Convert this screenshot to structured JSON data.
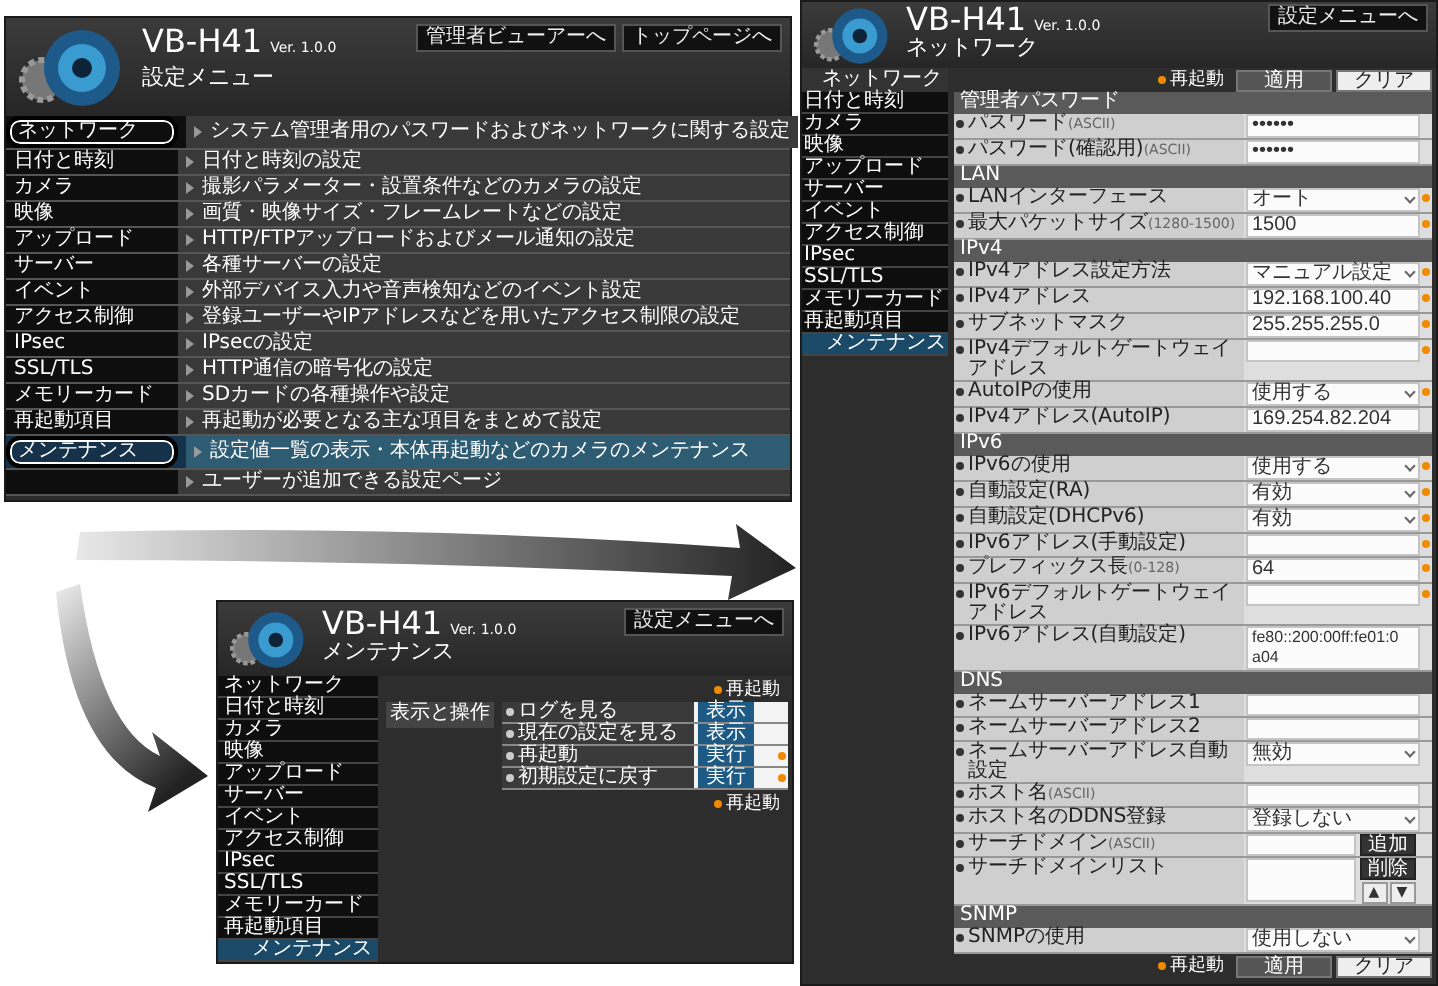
{
  "settings_menu": {
    "title": "VB-H41",
    "version": "Ver. 1.0.0",
    "header_buttons": [
      "管理者ビューアーへ",
      "トップページへ"
    ],
    "heading": "設定メニュー",
    "items": [
      {
        "name": "ネットワーク",
        "description": "システム管理者用のパスワードおよびネットワークに関する設定",
        "selected": false,
        "circled": true
      },
      {
        "name": "日付と時刻",
        "description": "日付と時刻の設定",
        "selected": false,
        "circled": false
      },
      {
        "name": "カメラ",
        "description": "撮影パラメーター・設置条件などのカメラの設定",
        "selected": false,
        "circled": false
      },
      {
        "name": "映像",
        "description": "画質・映像サイズ・フレームレートなどの設定",
        "selected": false,
        "circled": false
      },
      {
        "name": "アップロード",
        "description": "HTTP/FTPアップロードおよびメール通知の設定",
        "selected": false,
        "circled": false
      },
      {
        "name": "サーバー",
        "description": "各種サーバーの設定",
        "selected": false,
        "circled": false
      },
      {
        "name": "イベント",
        "description": "外部デバイス入力や音声検知などのイベント設定",
        "selected": false,
        "circled": false
      },
      {
        "name": "アクセス制御",
        "description": "登録ユーザーやIPアドレスなどを用いたアクセス制限の設定",
        "selected": false,
        "circled": false
      },
      {
        "name": "IPsec",
        "description": "IPsecの設定",
        "selected": false,
        "circled": false
      },
      {
        "name": "SSL/TLS",
        "description": "HTTP通信の暗号化の設定",
        "selected": false,
        "circled": false
      },
      {
        "name": "メモリーカード",
        "description": "SDカードの各種操作や設定",
        "selected": false,
        "circled": false
      },
      {
        "name": "再起動項目",
        "description": "再起動が必要となる主な項目をまとめて設定",
        "selected": false,
        "circled": false
      },
      {
        "name": "メンテナンス",
        "description": "設定値一覧の表示・本体再起動などのカメラのメンテナンス",
        "selected": true,
        "circled": true
      },
      {
        "description": "ユーザーが追加できる設定ページ",
        "selected": false,
        "circled": false
      }
    ]
  },
  "network_page": {
    "title": "VB-H41",
    "version": "Ver. 1.0.0",
    "header_button": "設定メニューへ",
    "heading": "ネットワーク",
    "current_item": "ネットワーク",
    "sidebar": [
      {
        "label": "日付と時刻",
        "selected": false
      },
      {
        "label": "カメラ",
        "selected": false
      },
      {
        "label": "映像",
        "selected": false
      },
      {
        "label": "アップロード",
        "selected": false
      },
      {
        "label": "サーバー",
        "selected": false
      },
      {
        "label": "イベント",
        "selected": false
      },
      {
        "label": "アクセス制御",
        "selected": false
      },
      {
        "label": "IPsec",
        "selected": false
      },
      {
        "label": "SSL/TLS",
        "selected": false
      },
      {
        "label": "メモリーカード",
        "selected": false
      },
      {
        "label": "再起動項目",
        "selected": false
      },
      {
        "label": "メンテナンス",
        "selected": true
      }
    ],
    "restart_note": "再起動",
    "buttons": [
      "適用",
      "クリア"
    ],
    "sections": [
      {
        "title": "管理者パスワード",
        "rows": [
          {
            "label": "パスワード",
            "hint": "(ASCII)",
            "value": "••••••",
            "kind": "text",
            "restart": false
          },
          {
            "label": "パスワード(確認用)",
            "hint": "(ASCII)",
            "value": "••••••",
            "kind": "text",
            "restart": false
          }
        ]
      },
      {
        "title": "LAN",
        "rows": [
          {
            "label": "LANインターフェース",
            "value": "オート",
            "kind": "select",
            "restart": true
          },
          {
            "label": "最大パケットサイズ",
            "hint": "(1280-1500)",
            "value": "1500",
            "kind": "text",
            "restart": true
          }
        ]
      },
      {
        "title": "IPv4",
        "rows": [
          {
            "label": "IPv4アドレス設定方法",
            "value": "マニュアル設定",
            "kind": "select",
            "restart": true
          },
          {
            "label": "IPv4アドレス",
            "value": "192.168.100.40",
            "kind": "text",
            "restart": true
          },
          {
            "label": "サブネットマスク",
            "value": "255.255.255.0",
            "kind": "text",
            "restart": true
          },
          {
            "label": "IPv4デフォルトゲートウェイアドレス",
            "kind": "text",
            "restart": true
          },
          {
            "label": "AutoIPの使用",
            "value": "使用する",
            "kind": "select",
            "restart": true
          },
          {
            "label": "IPv4アドレス(AutoIP)",
            "value": "169.254.82.204",
            "kind": "text",
            "restart": false
          }
        ]
      },
      {
        "title": "IPv6",
        "rows": [
          {
            "label": "IPv6の使用",
            "value": "使用する",
            "kind": "select",
            "restart": true
          },
          {
            "label": "自動設定(RA)",
            "value": "有効",
            "kind": "select",
            "restart": true
          },
          {
            "label": "自動設定(DHCPv6)",
            "value": "有効",
            "kind": "select",
            "restart": true
          },
          {
            "label": "IPv6アドレス(手動設定)",
            "kind": "text",
            "restart": true
          },
          {
            "label": "プレフィックス長",
            "hint": "(0-128)",
            "value": "64",
            "kind": "text",
            "restart": true
          },
          {
            "label": "IPv6デフォルトゲートウェイアドレス",
            "kind": "text",
            "restart": true
          },
          {
            "label": "IPv6アドレス(自動設定)",
            "kind": "list",
            "entries": [
              "fe80::200:00ff:fe01:0a04"
            ],
            "restart": false
          }
        ]
      },
      {
        "title": "DNS",
        "rows": [
          {
            "label": "ネームサーバーアドレス1",
            "kind": "text",
            "restart": false
          },
          {
            "label": "ネームサーバーアドレス2",
            "kind": "text",
            "restart": false
          },
          {
            "label": "ネームサーバーアドレス自動設定",
            "value": "無効",
            "kind": "select",
            "restart": false
          },
          {
            "label": "ホスト名",
            "hint": "(ASCII)",
            "kind": "text",
            "restart": false
          },
          {
            "label": "ホスト名のDDNS登録",
            "value": "登録しない",
            "kind": "select",
            "restart": false
          },
          {
            "label": "サーチドメイン",
            "hint": "(ASCII)",
            "kind": "text",
            "buttons": [
              "追加"
            ],
            "restart": false
          },
          {
            "label": "サーチドメインリスト",
            "kind": "list",
            "buttons": [
              "削除",
              "▲",
              "▼"
            ],
            "restart": false
          }
        ]
      },
      {
        "title": "SNMP",
        "rows": [
          {
            "label": "SNMPの使用",
            "value": "使用しない",
            "kind": "select",
            "restart": false
          }
        ]
      }
    ],
    "footer_restart_note": "再起動",
    "footer_buttons": [
      "適用",
      "クリア"
    ]
  },
  "maintenance_page": {
    "title": "VB-H41",
    "version": "Ver. 1.0.0",
    "header_button": "設定メニューへ",
    "heading": "メンテナンス",
    "sidebar": [
      {
        "label": "ネットワーク",
        "selected": false
      },
      {
        "label": "日付と時刻",
        "selected": false
      },
      {
        "label": "カメラ",
        "selected": false
      },
      {
        "label": "映像",
        "selected": false
      },
      {
        "label": "アップロード",
        "selected": false
      },
      {
        "label": "サーバー",
        "selected": false
      },
      {
        "label": "イベント",
        "selected": false
      },
      {
        "label": "アクセス制御",
        "selected": false
      },
      {
        "label": "IPsec",
        "selected": false
      },
      {
        "label": "SSL/TLS",
        "selected": false
      },
      {
        "label": "メモリーカード",
        "selected": false
      },
      {
        "label": "再起動項目",
        "selected": false
      },
      {
        "label": "メンテナンス",
        "selected": true
      }
    ],
    "restart_note": "再起動",
    "group": "表示と操作",
    "rows": [
      {
        "label": "ログを見る",
        "button": "表示",
        "restart": false
      },
      {
        "label": "現在の設定を見る",
        "button": "表示",
        "restart": false
      },
      {
        "label": "再起動",
        "button": "実行",
        "restart": true
      },
      {
        "label": "初期設定に戻す",
        "button": "実行",
        "restart": true
      }
    ],
    "footer_restart_note": "再起動"
  }
}
